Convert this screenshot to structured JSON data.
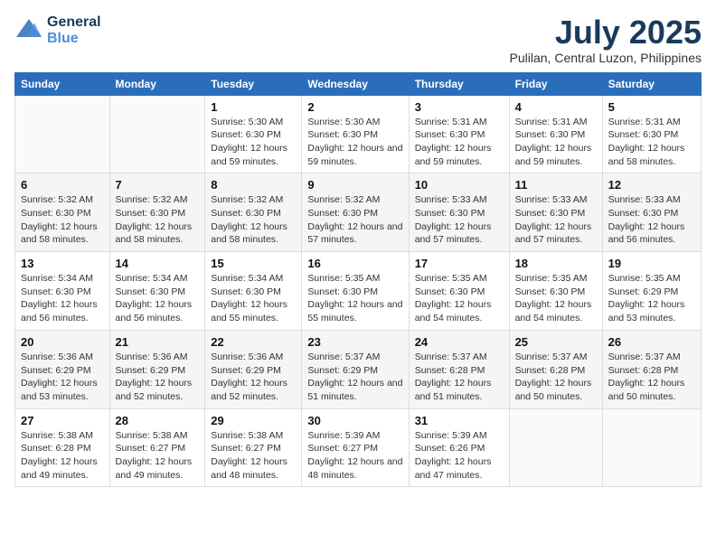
{
  "logo": {
    "general": "General",
    "blue": "Blue"
  },
  "title": {
    "month_year": "July 2025",
    "location": "Pulilan, Central Luzon, Philippines"
  },
  "days_of_week": [
    "Sunday",
    "Monday",
    "Tuesday",
    "Wednesday",
    "Thursday",
    "Friday",
    "Saturday"
  ],
  "weeks": [
    [
      {
        "num": "",
        "detail": ""
      },
      {
        "num": "",
        "detail": ""
      },
      {
        "num": "1",
        "detail": "Sunrise: 5:30 AM\nSunset: 6:30 PM\nDaylight: 12 hours and 59 minutes."
      },
      {
        "num": "2",
        "detail": "Sunrise: 5:30 AM\nSunset: 6:30 PM\nDaylight: 12 hours and 59 minutes."
      },
      {
        "num": "3",
        "detail": "Sunrise: 5:31 AM\nSunset: 6:30 PM\nDaylight: 12 hours and 59 minutes."
      },
      {
        "num": "4",
        "detail": "Sunrise: 5:31 AM\nSunset: 6:30 PM\nDaylight: 12 hours and 59 minutes."
      },
      {
        "num": "5",
        "detail": "Sunrise: 5:31 AM\nSunset: 6:30 PM\nDaylight: 12 hours and 58 minutes."
      }
    ],
    [
      {
        "num": "6",
        "detail": "Sunrise: 5:32 AM\nSunset: 6:30 PM\nDaylight: 12 hours and 58 minutes."
      },
      {
        "num": "7",
        "detail": "Sunrise: 5:32 AM\nSunset: 6:30 PM\nDaylight: 12 hours and 58 minutes."
      },
      {
        "num": "8",
        "detail": "Sunrise: 5:32 AM\nSunset: 6:30 PM\nDaylight: 12 hours and 58 minutes."
      },
      {
        "num": "9",
        "detail": "Sunrise: 5:32 AM\nSunset: 6:30 PM\nDaylight: 12 hours and 57 minutes."
      },
      {
        "num": "10",
        "detail": "Sunrise: 5:33 AM\nSunset: 6:30 PM\nDaylight: 12 hours and 57 minutes."
      },
      {
        "num": "11",
        "detail": "Sunrise: 5:33 AM\nSunset: 6:30 PM\nDaylight: 12 hours and 57 minutes."
      },
      {
        "num": "12",
        "detail": "Sunrise: 5:33 AM\nSunset: 6:30 PM\nDaylight: 12 hours and 56 minutes."
      }
    ],
    [
      {
        "num": "13",
        "detail": "Sunrise: 5:34 AM\nSunset: 6:30 PM\nDaylight: 12 hours and 56 minutes."
      },
      {
        "num": "14",
        "detail": "Sunrise: 5:34 AM\nSunset: 6:30 PM\nDaylight: 12 hours and 56 minutes."
      },
      {
        "num": "15",
        "detail": "Sunrise: 5:34 AM\nSunset: 6:30 PM\nDaylight: 12 hours and 55 minutes."
      },
      {
        "num": "16",
        "detail": "Sunrise: 5:35 AM\nSunset: 6:30 PM\nDaylight: 12 hours and 55 minutes."
      },
      {
        "num": "17",
        "detail": "Sunrise: 5:35 AM\nSunset: 6:30 PM\nDaylight: 12 hours and 54 minutes."
      },
      {
        "num": "18",
        "detail": "Sunrise: 5:35 AM\nSunset: 6:30 PM\nDaylight: 12 hours and 54 minutes."
      },
      {
        "num": "19",
        "detail": "Sunrise: 5:35 AM\nSunset: 6:29 PM\nDaylight: 12 hours and 53 minutes."
      }
    ],
    [
      {
        "num": "20",
        "detail": "Sunrise: 5:36 AM\nSunset: 6:29 PM\nDaylight: 12 hours and 53 minutes."
      },
      {
        "num": "21",
        "detail": "Sunrise: 5:36 AM\nSunset: 6:29 PM\nDaylight: 12 hours and 52 minutes."
      },
      {
        "num": "22",
        "detail": "Sunrise: 5:36 AM\nSunset: 6:29 PM\nDaylight: 12 hours and 52 minutes."
      },
      {
        "num": "23",
        "detail": "Sunrise: 5:37 AM\nSunset: 6:29 PM\nDaylight: 12 hours and 51 minutes."
      },
      {
        "num": "24",
        "detail": "Sunrise: 5:37 AM\nSunset: 6:28 PM\nDaylight: 12 hours and 51 minutes."
      },
      {
        "num": "25",
        "detail": "Sunrise: 5:37 AM\nSunset: 6:28 PM\nDaylight: 12 hours and 50 minutes."
      },
      {
        "num": "26",
        "detail": "Sunrise: 5:37 AM\nSunset: 6:28 PM\nDaylight: 12 hours and 50 minutes."
      }
    ],
    [
      {
        "num": "27",
        "detail": "Sunrise: 5:38 AM\nSunset: 6:28 PM\nDaylight: 12 hours and 49 minutes."
      },
      {
        "num": "28",
        "detail": "Sunrise: 5:38 AM\nSunset: 6:27 PM\nDaylight: 12 hours and 49 minutes."
      },
      {
        "num": "29",
        "detail": "Sunrise: 5:38 AM\nSunset: 6:27 PM\nDaylight: 12 hours and 48 minutes."
      },
      {
        "num": "30",
        "detail": "Sunrise: 5:39 AM\nSunset: 6:27 PM\nDaylight: 12 hours and 48 minutes."
      },
      {
        "num": "31",
        "detail": "Sunrise: 5:39 AM\nSunset: 6:26 PM\nDaylight: 12 hours and 47 minutes."
      },
      {
        "num": "",
        "detail": ""
      },
      {
        "num": "",
        "detail": ""
      }
    ]
  ]
}
